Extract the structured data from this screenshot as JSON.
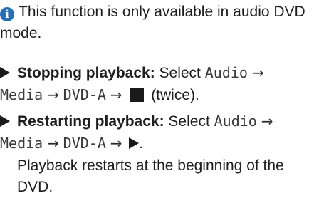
{
  "note": {
    "icon": "info-icon",
    "icon_glyph": "i",
    "text": "This function is only available in audio DVD mode."
  },
  "steps": [
    {
      "title": "Stopping playback:",
      "select": "Select",
      "path": [
        "Audio",
        "Media",
        "DVD-A"
      ],
      "arrow": "→",
      "end_icon": "stop-icon",
      "suffix": "(twice)."
    },
    {
      "title": "Restarting playback:",
      "select": "Select",
      "path": [
        "Audio",
        "Media",
        "DVD-A"
      ],
      "arrow": "→",
      "end_icon": "play-icon",
      "suffix": ".",
      "result": "Playback restarts at the beginning of the DVD."
    }
  ],
  "colors": {
    "info_icon": "#2370b8",
    "text": "#1e1e1e"
  }
}
